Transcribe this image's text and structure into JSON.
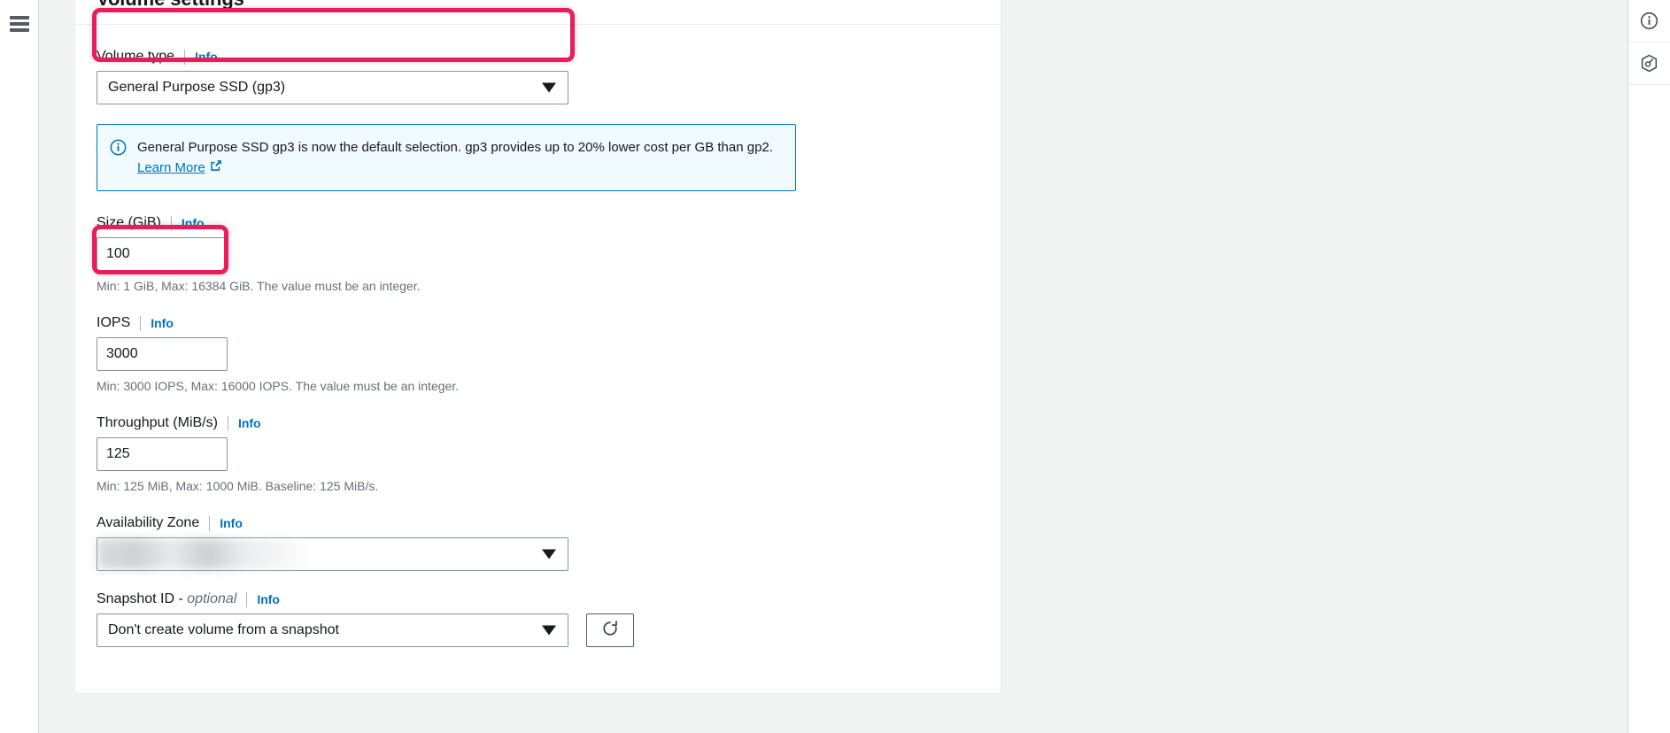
{
  "left_rail": {
    "menu_icon": "hamburger-menu-icon"
  },
  "card": {
    "title": "Volume settings"
  },
  "fields": {
    "volume_type": {
      "label": "Volume type",
      "info": "Info",
      "value": "General Purpose SSD (gp3)",
      "caret_icon": "chevron-down-icon"
    },
    "alert": {
      "icon": "info-circle-icon",
      "text": "General Purpose SSD gp3 is now the default selection. gp3 provides up to 20% lower cost per GB than gp2.",
      "link_text": "Learn More",
      "link_icon": "external-link-icon"
    },
    "size": {
      "label": "Size (GiB)",
      "info": "Info",
      "value": "100",
      "hint": "Min: 1 GiB, Max: 16384 GiB. The value must be an integer."
    },
    "iops": {
      "label": "IOPS",
      "info": "Info",
      "value": "3000",
      "hint": "Min: 3000 IOPS, Max: 16000 IOPS. The value must be an integer."
    },
    "throughput": {
      "label": "Throughput (MiB/s)",
      "info": "Info",
      "value": "125",
      "hint": "Min: 125 MiB, Max: 1000 MiB. Baseline: 125 MiB/s."
    },
    "availability_zone": {
      "label": "Availability Zone",
      "info": "Info",
      "value": "",
      "caret_icon": "chevron-down-icon"
    },
    "snapshot_id": {
      "label": "Snapshot ID - ",
      "label_optional": "optional",
      "info": "Info",
      "value": "Don't create volume from a snapshot",
      "caret_icon": "chevron-down-icon",
      "refresh_icon": "refresh-icon"
    }
  },
  "right_rail": {
    "items": [
      {
        "name": "info-panel-icon"
      },
      {
        "name": "security-shield-icon"
      }
    ]
  },
  "colors": {
    "highlight": "#ec1b5a",
    "link": "#0073bb",
    "alert_bg": "#f1faff",
    "alert_border": "#0073bb"
  }
}
